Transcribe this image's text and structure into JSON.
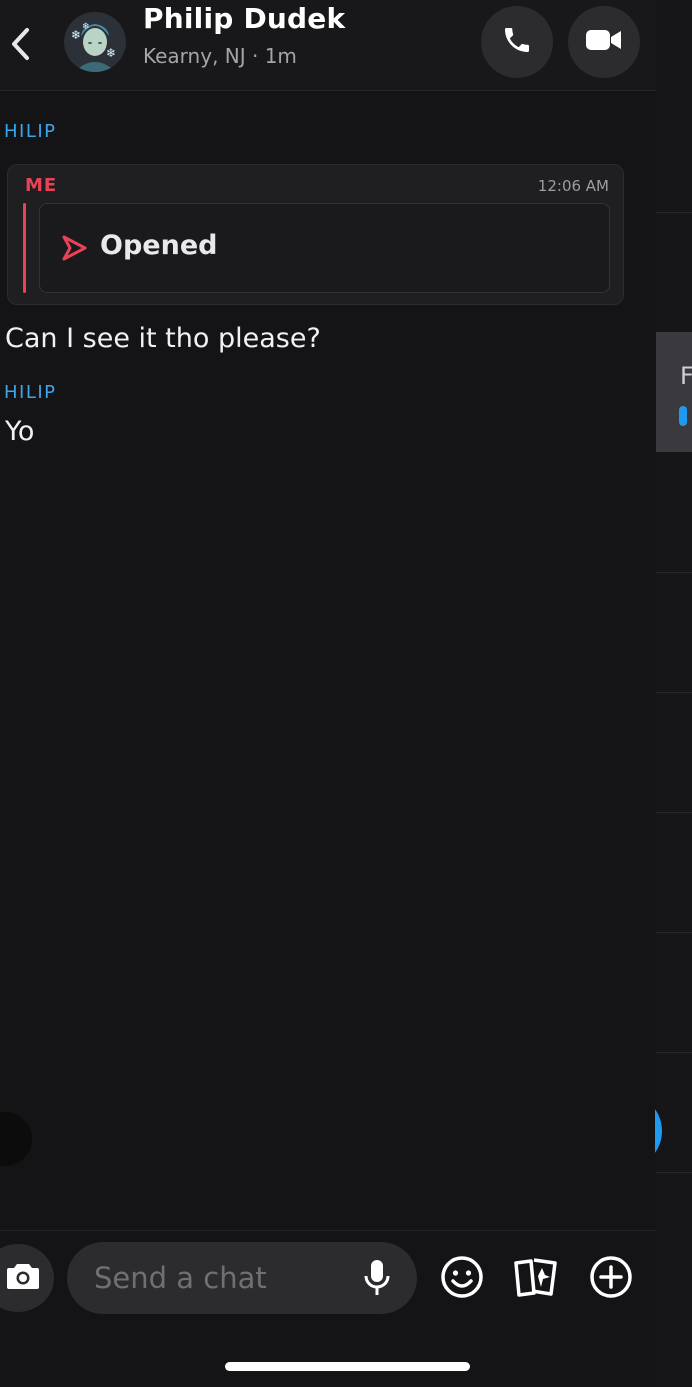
{
  "header": {
    "contact_name": "Philip Dudek",
    "status": "Kearny, NJ · 1m",
    "icons": {
      "back": "chevron-left-icon",
      "call": "phone-icon",
      "video": "video-camera-icon"
    }
  },
  "messages": [
    {
      "sender": "HILIP"
    },
    {
      "quoted": {
        "sender": "ME",
        "time": "12:06 AM",
        "snap_status": "Opened",
        "icon": "opened-snap-arrow-icon"
      },
      "text": "Can I see it tho please?"
    },
    {
      "sender": "HILIP",
      "text": "Yo"
    }
  ],
  "composer": {
    "placeholder": "Send a chat",
    "icons": [
      "camera-icon",
      "microphone-icon",
      "emoji-icon",
      "cards-icon",
      "plus-icon"
    ]
  },
  "background_peek": {
    "letter": "F"
  },
  "colors": {
    "accent_blue": "#3aa6ee",
    "me_red": "#e84256",
    "background": "#141416"
  }
}
